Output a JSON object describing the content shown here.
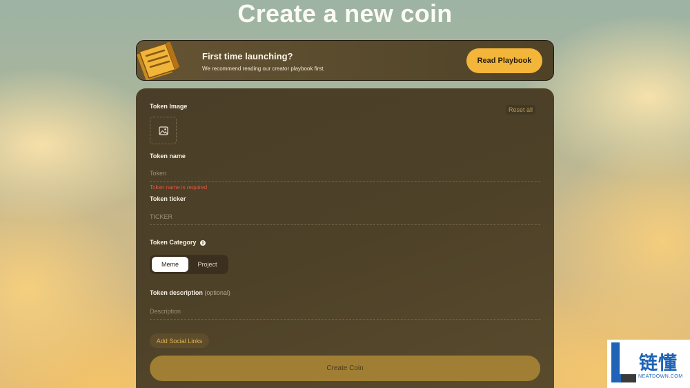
{
  "page": {
    "title": "Create a new coin"
  },
  "banner": {
    "title": "First time launching?",
    "subtitle": "We recommend reading our creator playbook first.",
    "button_label": "Read Playbook",
    "icon": "book-icon"
  },
  "form": {
    "reset_label": "Reset all",
    "token_image": {
      "label": "Token Image",
      "icon": "image-icon"
    },
    "token_name": {
      "label": "Token name",
      "placeholder": "Token",
      "value": "",
      "error": "Token name is required"
    },
    "token_ticker": {
      "label": "Token ticker",
      "placeholder": "TICKER",
      "value": ""
    },
    "token_category": {
      "label": "Token Category",
      "info_icon": "info-icon",
      "options": [
        "Meme",
        "Project"
      ],
      "selected": "Meme"
    },
    "token_description": {
      "label": "Token description",
      "optional": "(optional)",
      "placeholder": "Description",
      "value": ""
    },
    "social_button_label": "Add Social Links",
    "submit_label": "Create Coin"
  },
  "watermark": {
    "logo_letter": "L",
    "text": "链懂",
    "subtext": "NEATDOWN.COM"
  },
  "colors": {
    "accent": "#f3b63a",
    "error": "#e9553c",
    "card": "#4a3e28",
    "submit_button": "#a07f34"
  }
}
